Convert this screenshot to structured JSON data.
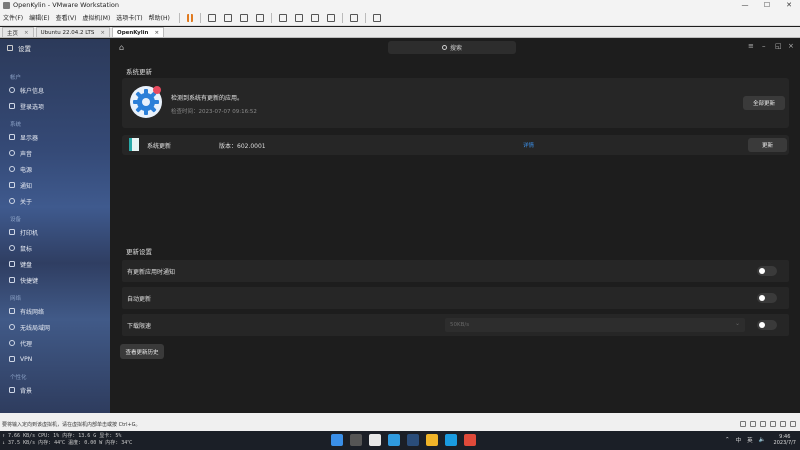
{
  "vm": {
    "window_title": "OpenKylin - VMware Workstation",
    "menu": [
      "文件(F)",
      "编辑(E)",
      "查看(V)",
      "虚拟机(M)",
      "选项卡(T)",
      "帮助(H)"
    ],
    "tabs": [
      {
        "label": "主页"
      },
      {
        "label": "Ubuntu 22.04.2 LTS"
      },
      {
        "label": "OpenKylin"
      }
    ],
    "status_text": "要将输入定向到该虚拟机，请在虚拟机内部单击或按 Ctrl+G。"
  },
  "sidebar": {
    "title": "设置",
    "groups": [
      {
        "label": "帐户",
        "items": [
          {
            "label": "帐户信息"
          },
          {
            "label": "登录选项"
          }
        ]
      },
      {
        "label": "系统",
        "items": [
          {
            "label": "显示器"
          },
          {
            "label": "声音"
          },
          {
            "label": "电源"
          },
          {
            "label": "通知"
          },
          {
            "label": "关于"
          }
        ]
      },
      {
        "label": "设备",
        "items": [
          {
            "label": "打印机"
          },
          {
            "label": "鼠标"
          },
          {
            "label": "键盘"
          },
          {
            "label": "快捷键"
          }
        ]
      },
      {
        "label": "网络",
        "items": [
          {
            "label": "有线网络"
          },
          {
            "label": "无线局域网"
          },
          {
            "label": "代理"
          },
          {
            "label": "VPN"
          }
        ]
      },
      {
        "label": "个性化",
        "items": [
          {
            "label": "背景"
          }
        ]
      }
    ]
  },
  "main": {
    "search_placeholder": "搜索",
    "section_update": "系统更新",
    "update_message": "检测到系统有更新的应用。",
    "check_time": "检查时间：2023-07-07 09:16:52",
    "update_all_button": "全部更新",
    "update_item": {
      "name": "系统更新",
      "version": "版本：602.0001",
      "details": "详情",
      "button": "更新"
    },
    "section_settings": "更新设置",
    "settings": [
      {
        "label": "有更新应用时通知",
        "enabled": false
      },
      {
        "label": "自动更新",
        "enabled": false
      },
      {
        "label": "下载限速",
        "enabled": false,
        "value": "50KB/s"
      }
    ],
    "history_button": "查看更新历史"
  },
  "taskbar": {
    "perf_line1": "↑ 7.66 KB/s CPU: 1% 内存: 13.6 G 显卡: 5%",
    "perf_line2": "↓ 37.5 KB/s 内存: 44℃ 温度: 0.00 W 内存: 34℃",
    "ime": "中",
    "lang": "英",
    "time": "9:46",
    "date": "2023/7/7"
  },
  "colors": {
    "accent_blue": "#3b8fe8",
    "gear_blue": "#2b7fd8",
    "badge_red": "#e84a5f",
    "teal": "#2aa9a8"
  }
}
